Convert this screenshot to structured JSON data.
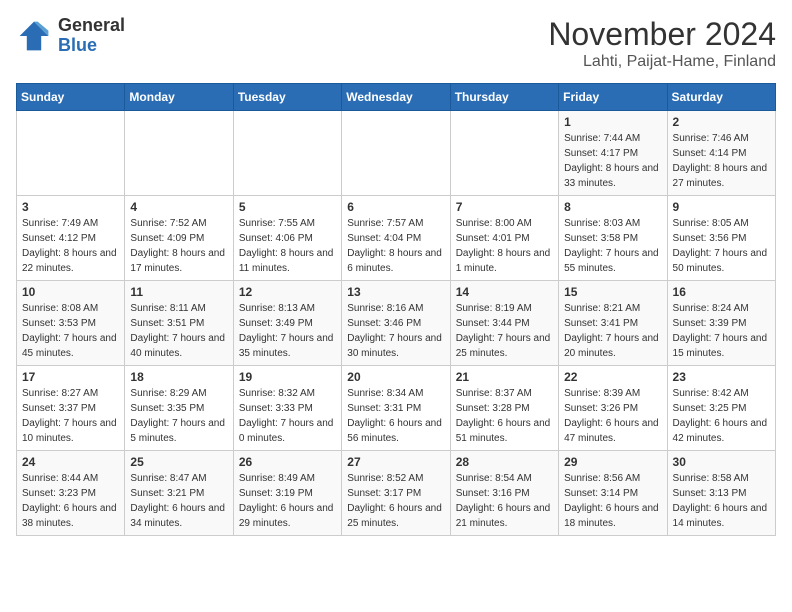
{
  "logo": {
    "general": "General",
    "blue": "Blue"
  },
  "header": {
    "month": "November 2024",
    "location": "Lahti, Paijat-Hame, Finland"
  },
  "weekdays": [
    "Sunday",
    "Monday",
    "Tuesday",
    "Wednesday",
    "Thursday",
    "Friday",
    "Saturday"
  ],
  "weeks": [
    [
      {
        "day": "",
        "sunrise": "",
        "sunset": "",
        "daylight": ""
      },
      {
        "day": "",
        "sunrise": "",
        "sunset": "",
        "daylight": ""
      },
      {
        "day": "",
        "sunrise": "",
        "sunset": "",
        "daylight": ""
      },
      {
        "day": "",
        "sunrise": "",
        "sunset": "",
        "daylight": ""
      },
      {
        "day": "",
        "sunrise": "",
        "sunset": "",
        "daylight": ""
      },
      {
        "day": "1",
        "sunrise": "Sunrise: 7:44 AM",
        "sunset": "Sunset: 4:17 PM",
        "daylight": "Daylight: 8 hours and 33 minutes."
      },
      {
        "day": "2",
        "sunrise": "Sunrise: 7:46 AM",
        "sunset": "Sunset: 4:14 PM",
        "daylight": "Daylight: 8 hours and 27 minutes."
      }
    ],
    [
      {
        "day": "3",
        "sunrise": "Sunrise: 7:49 AM",
        "sunset": "Sunset: 4:12 PM",
        "daylight": "Daylight: 8 hours and 22 minutes."
      },
      {
        "day": "4",
        "sunrise": "Sunrise: 7:52 AM",
        "sunset": "Sunset: 4:09 PM",
        "daylight": "Daylight: 8 hours and 17 minutes."
      },
      {
        "day": "5",
        "sunrise": "Sunrise: 7:55 AM",
        "sunset": "Sunset: 4:06 PM",
        "daylight": "Daylight: 8 hours and 11 minutes."
      },
      {
        "day": "6",
        "sunrise": "Sunrise: 7:57 AM",
        "sunset": "Sunset: 4:04 PM",
        "daylight": "Daylight: 8 hours and 6 minutes."
      },
      {
        "day": "7",
        "sunrise": "Sunrise: 8:00 AM",
        "sunset": "Sunset: 4:01 PM",
        "daylight": "Daylight: 8 hours and 1 minute."
      },
      {
        "day": "8",
        "sunrise": "Sunrise: 8:03 AM",
        "sunset": "Sunset: 3:58 PM",
        "daylight": "Daylight: 7 hours and 55 minutes."
      },
      {
        "day": "9",
        "sunrise": "Sunrise: 8:05 AM",
        "sunset": "Sunset: 3:56 PM",
        "daylight": "Daylight: 7 hours and 50 minutes."
      }
    ],
    [
      {
        "day": "10",
        "sunrise": "Sunrise: 8:08 AM",
        "sunset": "Sunset: 3:53 PM",
        "daylight": "Daylight: 7 hours and 45 minutes."
      },
      {
        "day": "11",
        "sunrise": "Sunrise: 8:11 AM",
        "sunset": "Sunset: 3:51 PM",
        "daylight": "Daylight: 7 hours and 40 minutes."
      },
      {
        "day": "12",
        "sunrise": "Sunrise: 8:13 AM",
        "sunset": "Sunset: 3:49 PM",
        "daylight": "Daylight: 7 hours and 35 minutes."
      },
      {
        "day": "13",
        "sunrise": "Sunrise: 8:16 AM",
        "sunset": "Sunset: 3:46 PM",
        "daylight": "Daylight: 7 hours and 30 minutes."
      },
      {
        "day": "14",
        "sunrise": "Sunrise: 8:19 AM",
        "sunset": "Sunset: 3:44 PM",
        "daylight": "Daylight: 7 hours and 25 minutes."
      },
      {
        "day": "15",
        "sunrise": "Sunrise: 8:21 AM",
        "sunset": "Sunset: 3:41 PM",
        "daylight": "Daylight: 7 hours and 20 minutes."
      },
      {
        "day": "16",
        "sunrise": "Sunrise: 8:24 AM",
        "sunset": "Sunset: 3:39 PM",
        "daylight": "Daylight: 7 hours and 15 minutes."
      }
    ],
    [
      {
        "day": "17",
        "sunrise": "Sunrise: 8:27 AM",
        "sunset": "Sunset: 3:37 PM",
        "daylight": "Daylight: 7 hours and 10 minutes."
      },
      {
        "day": "18",
        "sunrise": "Sunrise: 8:29 AM",
        "sunset": "Sunset: 3:35 PM",
        "daylight": "Daylight: 7 hours and 5 minutes."
      },
      {
        "day": "19",
        "sunrise": "Sunrise: 8:32 AM",
        "sunset": "Sunset: 3:33 PM",
        "daylight": "Daylight: 7 hours and 0 minutes."
      },
      {
        "day": "20",
        "sunrise": "Sunrise: 8:34 AM",
        "sunset": "Sunset: 3:31 PM",
        "daylight": "Daylight: 6 hours and 56 minutes."
      },
      {
        "day": "21",
        "sunrise": "Sunrise: 8:37 AM",
        "sunset": "Sunset: 3:28 PM",
        "daylight": "Daylight: 6 hours and 51 minutes."
      },
      {
        "day": "22",
        "sunrise": "Sunrise: 8:39 AM",
        "sunset": "Sunset: 3:26 PM",
        "daylight": "Daylight: 6 hours and 47 minutes."
      },
      {
        "day": "23",
        "sunrise": "Sunrise: 8:42 AM",
        "sunset": "Sunset: 3:25 PM",
        "daylight": "Daylight: 6 hours and 42 minutes."
      }
    ],
    [
      {
        "day": "24",
        "sunrise": "Sunrise: 8:44 AM",
        "sunset": "Sunset: 3:23 PM",
        "daylight": "Daylight: 6 hours and 38 minutes."
      },
      {
        "day": "25",
        "sunrise": "Sunrise: 8:47 AM",
        "sunset": "Sunset: 3:21 PM",
        "daylight": "Daylight: 6 hours and 34 minutes."
      },
      {
        "day": "26",
        "sunrise": "Sunrise: 8:49 AM",
        "sunset": "Sunset: 3:19 PM",
        "daylight": "Daylight: 6 hours and 29 minutes."
      },
      {
        "day": "27",
        "sunrise": "Sunrise: 8:52 AM",
        "sunset": "Sunset: 3:17 PM",
        "daylight": "Daylight: 6 hours and 25 minutes."
      },
      {
        "day": "28",
        "sunrise": "Sunrise: 8:54 AM",
        "sunset": "Sunset: 3:16 PM",
        "daylight": "Daylight: 6 hours and 21 minutes."
      },
      {
        "day": "29",
        "sunrise": "Sunrise: 8:56 AM",
        "sunset": "Sunset: 3:14 PM",
        "daylight": "Daylight: 6 hours and 18 minutes."
      },
      {
        "day": "30",
        "sunrise": "Sunrise: 8:58 AM",
        "sunset": "Sunset: 3:13 PM",
        "daylight": "Daylight: 6 hours and 14 minutes."
      }
    ]
  ]
}
